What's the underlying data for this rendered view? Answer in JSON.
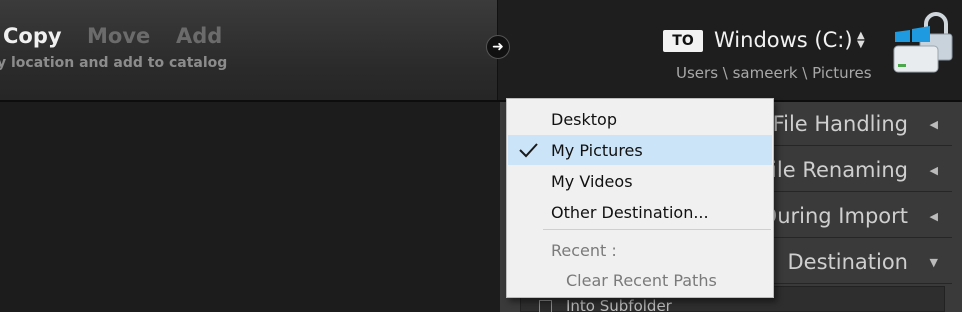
{
  "import_modes": {
    "copy": "Copy",
    "move": "Move",
    "add": "Add",
    "description": "y location and add to catalog"
  },
  "destination": {
    "to_badge": "TO",
    "drive_name": "Windows (C:)",
    "path": "Users \\ sameerk \\ Pictures",
    "icons": {
      "arrow": "arrow-right-icon",
      "drive": "windows-drive-lock-icon",
      "updown": "up-down-arrows-icon"
    }
  },
  "panel": {
    "sections": {
      "file_handling": "File Handling",
      "file_renaming": "File Renaming",
      "during_import": "During Import",
      "destination": "Destination"
    },
    "subfolder_label": "Into Subfolder"
  },
  "dropdown": {
    "items": [
      "Desktop",
      "My Pictures",
      "My Videos",
      "Other Destination..."
    ],
    "selected": "My Pictures",
    "recent_label": "Recent :",
    "clear_recent": "Clear Recent Paths"
  },
  "colors": {
    "menu_bg": "#f0f0f0",
    "menu_selected": "#cce4f7",
    "panel_bg": "#3a3a3a",
    "topbar_bg": "#2a2a2a"
  }
}
